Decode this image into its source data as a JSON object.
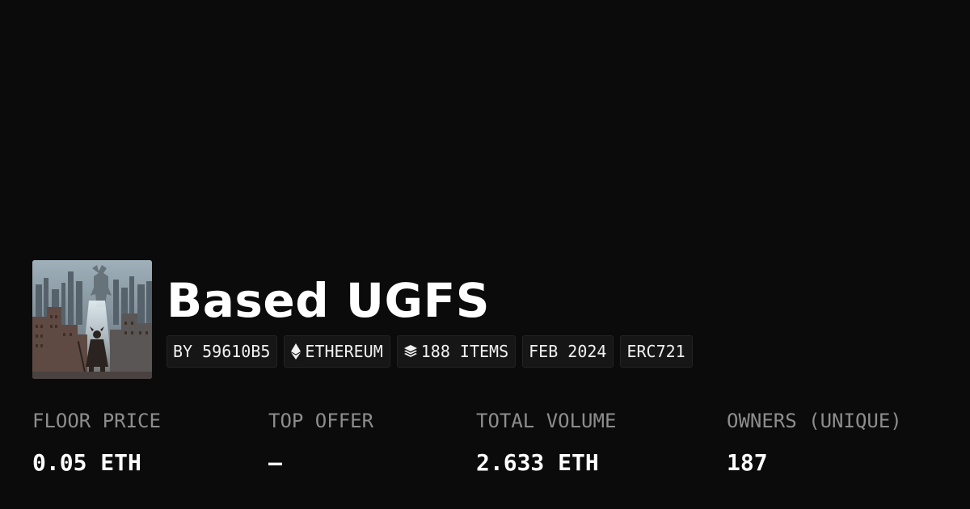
{
  "collection": {
    "name": "Based UGFS",
    "image_icon": "collection-artwork-city-warrior"
  },
  "chips": [
    {
      "label": "BY 59610B5",
      "icon": null
    },
    {
      "label": "ETHEREUM",
      "icon": "ethereum-icon"
    },
    {
      "label": "188 ITEMS",
      "icon": "layers-icon"
    },
    {
      "label": "FEB 2024",
      "icon": null
    },
    {
      "label": "ERC721",
      "icon": null
    }
  ],
  "stats": [
    {
      "label": "FLOOR PRICE",
      "value": "0.05 ETH"
    },
    {
      "label": "TOP OFFER",
      "value": "—"
    },
    {
      "label": "TOTAL VOLUME",
      "value": "2.633 ETH"
    },
    {
      "label": "OWNERS (UNIQUE)",
      "value": "187"
    }
  ],
  "colors": {
    "background": "#0b0b0b",
    "chip_background": "#161616",
    "label_gray": "#8d8d8d",
    "text_white": "#ffffff"
  }
}
